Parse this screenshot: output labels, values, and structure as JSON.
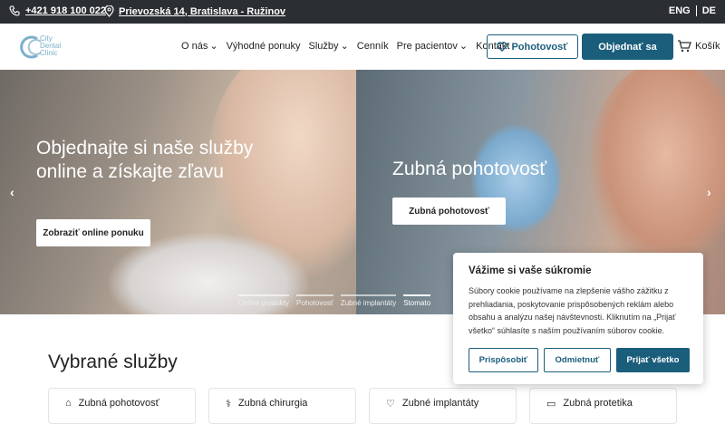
{
  "topbar": {
    "phone": "+421 918 100 022",
    "address": "Prievozská 14, Bratislava - Ružinov",
    "lang_en": "ENG",
    "lang_de": "DE"
  },
  "logo": {
    "line1": "City",
    "line2": "Dental",
    "line3": "Clinic"
  },
  "nav": {
    "items": [
      "O nás",
      "Výhodné ponuky",
      "Služby",
      "Cenník",
      "Pre pacientov",
      "Kontakt"
    ],
    "emergency_button": "Pohotovosť",
    "book_button": "Objednať sa",
    "cart": "Košík"
  },
  "hero": {
    "slide1_title": "Objednajte si naše služby online a získajte zľavu",
    "slide1_button": "Zobraziť online ponuku",
    "slide2_title": "Zubná pohotovosť",
    "slide2_button": "Zubná pohotovosť",
    "indicators": [
      "Online produkty",
      "Pohotovosť",
      "Zubné implantáty",
      "Stomato"
    ]
  },
  "section": {
    "title": "Vybrané služby",
    "cards": [
      "Zubná pohotovosť",
      "Zubná chirurgia",
      "Zubné implantáty",
      "Zubná protetika"
    ]
  },
  "cookie": {
    "title": "Vážime si vaše súkromie",
    "text": "Súbory cookie používame na zlepšenie vášho zážitku z prehliadania, poskytovanie prispôsobených reklám alebo obsahu a analýzu našej návštevnosti. Kliknutím na „Prijať všetko“ súhlasíte s naším používaním súborov cookie.",
    "customize": "Prispôsobiť",
    "reject": "Odmietnuť",
    "accept": "Prijať všetko"
  },
  "colors": {
    "brand": "#1b5e7c",
    "topbar": "#2b2f33"
  }
}
